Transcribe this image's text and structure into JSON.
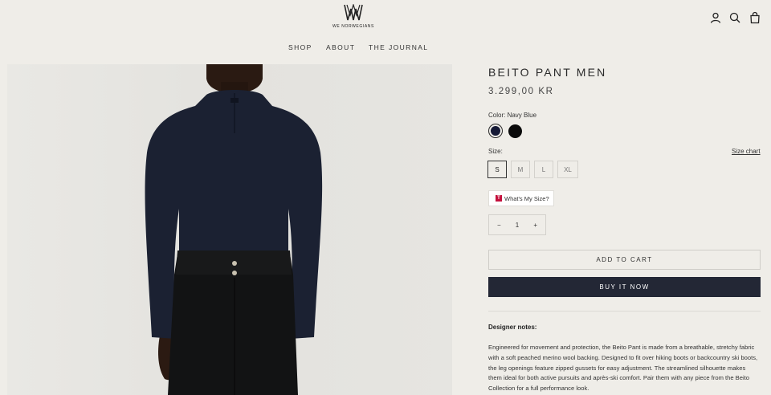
{
  "brand": {
    "name": "WE NORWEGIANS"
  },
  "nav": {
    "items": [
      "SHOP",
      "ABOUT",
      "THE JOURNAL"
    ]
  },
  "header_icons": [
    "account-icon",
    "search-icon",
    "cart-icon"
  ],
  "product": {
    "title": "BEITO PANT MEN",
    "price": "3.299,00 KR",
    "color_label": "Color: Navy Blue",
    "colors": [
      {
        "name": "Navy Blue",
        "hex": "#161a36",
        "selected": true
      },
      {
        "name": "Black",
        "hex": "#0b0b0b",
        "selected": false
      }
    ],
    "size_label": "Size:",
    "size_chart": "Size chart",
    "sizes": [
      "S",
      "M",
      "L",
      "XL"
    ],
    "selected_size": "S",
    "whats_my_size": "What's My Size?",
    "quantity": "1",
    "qty_minus": "−",
    "qty_plus": "+",
    "add_to_cart": "ADD TO CART",
    "buy_now": "BUY IT NOW",
    "notes_heading": "Designer notes:",
    "notes_text": "Engineered for movement and protection, the Beito Pant is made from a breathable, stretchy fabric with a soft peached merino wool backing. Designed to fit over hiking boots or backcountry ski boots, the leg openings feature zipped gussets for easy adjustment. The streamlined silhouette makes them ideal for both active pursuits and après-ski comfort. Pair them with any piece from the Beito Collection for a full performance look."
  },
  "colors": {
    "background": "#efede8",
    "buy_button": "#232735",
    "image_bg": "#e6e5e1"
  }
}
